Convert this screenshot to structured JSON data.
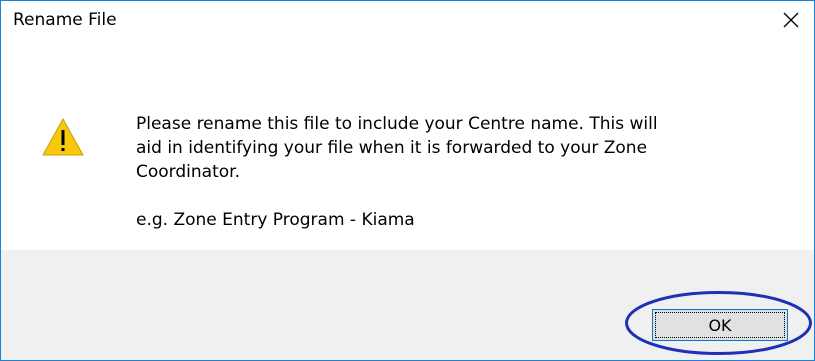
{
  "dialog": {
    "title": "Rename File",
    "close_icon": "close-icon",
    "warning_icon": "warning-triangle-icon",
    "message_lines": [
      "Please rename this file to include your Centre name.  This will",
      "aid in identifying your file when it is forwarded to your Zone",
      "Coordinator."
    ],
    "example": "e.g.  Zone Entry Program - Kiama",
    "ok_label": "OK"
  },
  "colors": {
    "border": "#1883d7",
    "footer_bg": "#f0f0f0",
    "button_bg": "#e1e1e1",
    "button_border": "#0078d7",
    "warning_yellow": "#f7c80b",
    "annotation_ellipse": "#1f2fb8"
  }
}
